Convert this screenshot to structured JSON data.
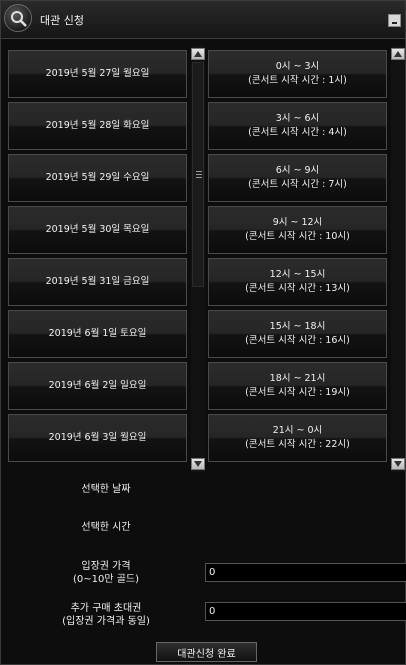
{
  "window": {
    "title": "대관 신청",
    "icon": "magnifier-icon"
  },
  "dates": [
    "2019년 5월 27일 월요일",
    "2019년 5월 28일 화요일",
    "2019년 5월 29일 수요일",
    "2019년 5월 30일 목요일",
    "2019년 5월 31일 금요일",
    "2019년 6월 1일 토요일",
    "2019년 6월 2일 일요일",
    "2019년 6월 3일 월요일"
  ],
  "times": [
    {
      "range": "0시 ~ 3시",
      "start": "(콘서트 시작 시간 : 1시)"
    },
    {
      "range": "3시 ~ 6시",
      "start": "(콘서트 시작 시간 : 4시)"
    },
    {
      "range": "6시 ~ 9시",
      "start": "(콘서트 시작 시간 : 7시)"
    },
    {
      "range": "9시 ~ 12시",
      "start": "(콘서트 시작 시간 : 10시)"
    },
    {
      "range": "12시 ~ 15시",
      "start": "(콘서트 시작 시간 : 13시)"
    },
    {
      "range": "15시 ~ 18시",
      "start": "(콘서트 시작 시간 : 16시)"
    },
    {
      "range": "18시 ~ 21시",
      "start": "(콘서트 시작 시간 : 19시)"
    },
    {
      "range": "21시 ~ 0시",
      "start": "(콘서트 시작 시간 : 22시)"
    }
  ],
  "form": {
    "selected_date_label": "선택한 날짜",
    "selected_time_label": "선택한 시간",
    "ticket_price_label_1": "입장권 가격",
    "ticket_price_label_2": "(0~10만 골드)",
    "ticket_price_value": "0",
    "invites_label_1": "추가 구매 초대권",
    "invites_label_2": "(입장권 가격과 동일)",
    "invites_value": "0"
  },
  "submit_label": "대관신청 완료"
}
